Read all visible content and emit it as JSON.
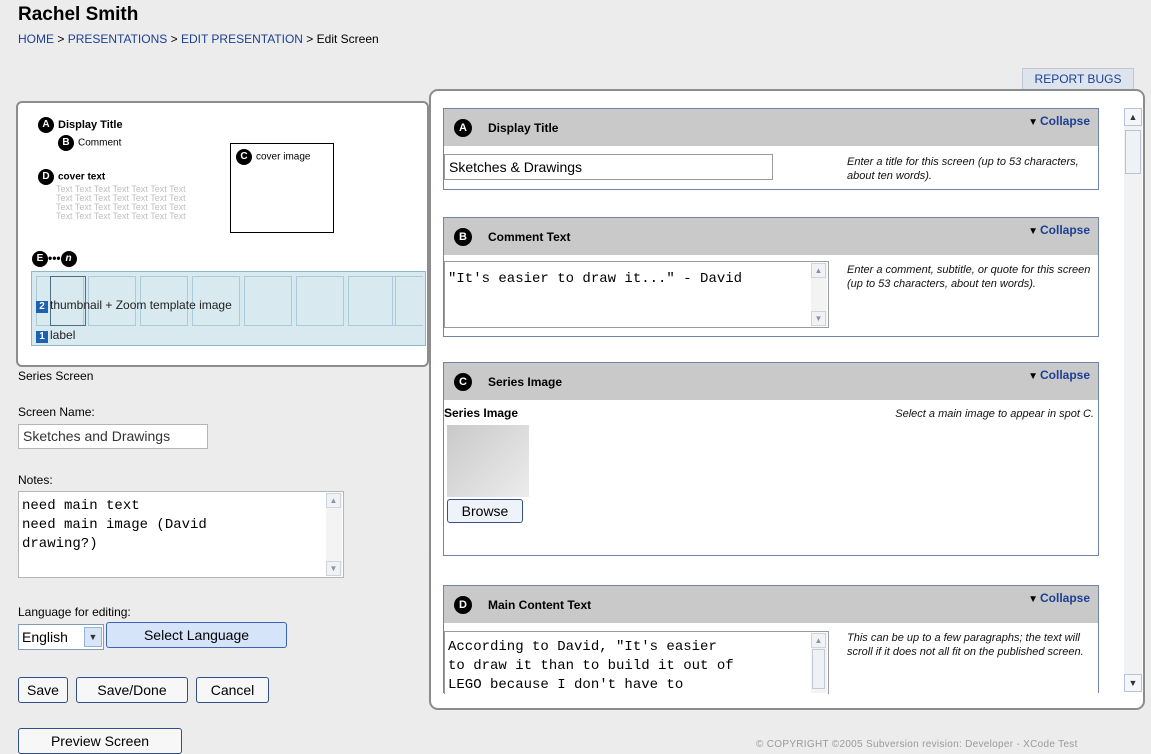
{
  "header": {
    "user_name": "Rachel Smith",
    "breadcrumb": {
      "home": "HOME",
      "presentations": "PRESENTATIONS",
      "edit_presentation": "EDIT PRESENTATION",
      "current": "Edit Screen",
      "separator": " > "
    },
    "report_bugs": "REPORT BUGS"
  },
  "template_preview": {
    "display_title": {
      "badge": "A",
      "label": "Display Title"
    },
    "comment": {
      "badge": "B",
      "label": "Comment"
    },
    "cover_image": {
      "badge": "C",
      "label": "cover image"
    },
    "cover_text": {
      "badge": "D",
      "label": "cover text"
    },
    "filler_text": "Text Text Text Text Text Text Text Text Text Text Text Text Text Text Text Text Text Text Text Text Text Text Text Text Text Text Text Text",
    "range": {
      "start": "E",
      "dots": "•••",
      "end": "n"
    },
    "thumbnail": {
      "badge": "2",
      "label": "thumbnail + Zoom template image"
    },
    "label": {
      "badge": "1",
      "label": "label"
    }
  },
  "left_form": {
    "screen_type": "Series Screen",
    "screen_name_label": "Screen Name:",
    "screen_name_value": "Sketches and Drawings",
    "notes_label": "Notes:",
    "notes_value": "need main text\nneed main image (David\ndrawing?)",
    "language_label": "Language for editing:",
    "language_value": "English",
    "select_language": "Select Language",
    "save": "Save",
    "save_done": "Save/Done",
    "cancel": "Cancel",
    "preview_screen": "Preview Screen"
  },
  "sections": {
    "display_title": {
      "badge": "A",
      "title": "Display Title",
      "collapse": "Collapse",
      "value": "Sketches & Drawings",
      "help": "Enter a title for this screen (up to 53 characters, about ten words)."
    },
    "comment_text": {
      "badge": "B",
      "title": "Comment Text",
      "collapse": "Collapse",
      "value": "\"It's easier to draw it...\" - David",
      "help": "Enter a comment, subtitle, or quote for this screen (up to 53 characters, about ten words)."
    },
    "series_image": {
      "badge": "C",
      "title": "Series Image",
      "collapse": "Collapse",
      "field_label": "Series Image",
      "browse": "Browse",
      "help": "Select a main image to appear in spot C."
    },
    "main_content_text": {
      "badge": "D",
      "title": "Main Content Text",
      "collapse": "Collapse",
      "value": "According to David, \"It's easier\nto draw it than to build it out of\nLEGO because I don't have to",
      "help": "This can be up to a few paragraphs; the text will scroll if it does not all fit on the published screen."
    }
  },
  "footer": {
    "copyright": "© COPYRIGHT ©2005 Subversion revision: Developer - XCode Test"
  }
}
